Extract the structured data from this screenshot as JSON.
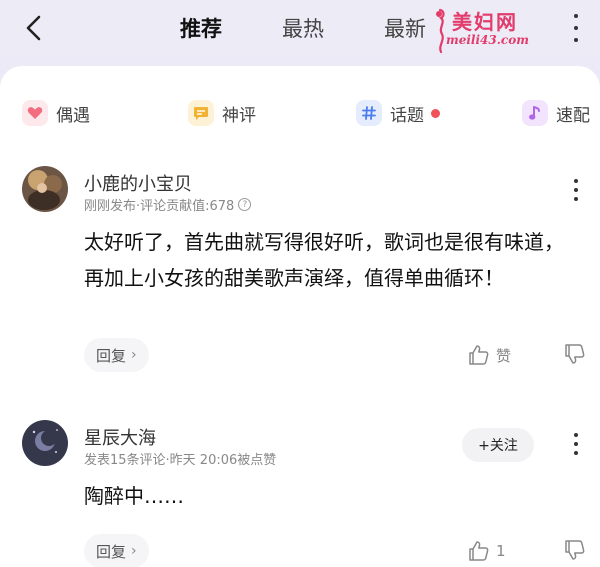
{
  "header": {
    "tabs": [
      {
        "label": "推荐",
        "active": true
      },
      {
        "label": "最热",
        "active": false
      },
      {
        "label": "最新",
        "active": false
      }
    ],
    "watermark_title": "美妇网",
    "watermark_url": "meili43.com"
  },
  "chips": [
    {
      "label": "偶遇",
      "icon": "heart-icon",
      "color": "#f26d7f"
    },
    {
      "label": "神评",
      "icon": "comment-icon",
      "color": "#f2b233"
    },
    {
      "label": "话题",
      "icon": "hashtag-icon",
      "color": "#4a7cf0",
      "has_dot": true
    },
    {
      "label": "速配",
      "icon": "music-note-icon",
      "color": "#b066e8"
    }
  ],
  "comments": [
    {
      "username": "小鹿的小宝贝",
      "meta": "刚刚发布·评论贡献值:678",
      "text": "太好听了，首先曲就写得很好听，歌词也是很有味道，再加上小女孩的甜美歌声演绎，值得单曲循环！",
      "reply_label": "回复",
      "like_label": "赞"
    },
    {
      "username": "星辰大海",
      "meta": "发表15条评论·昨天 20:06被点赞",
      "follow_label": "+关注",
      "text": "陶醉中……",
      "reply_label": "回复",
      "like_label": "1"
    }
  ]
}
